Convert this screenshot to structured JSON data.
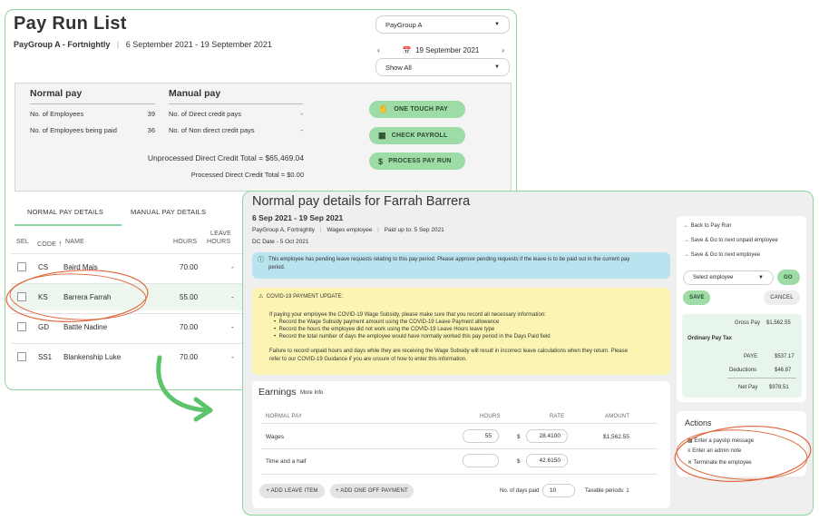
{
  "pay_run": {
    "title": "Pay Run List",
    "group_label": "PayGroup A - Fortnightly",
    "period": "6 September 2021 - 19 September 2021",
    "paygroup_select": "PayGroup A",
    "date_nav": "19 September 2021",
    "filter_select": "Show All",
    "normal_pay": {
      "heading": "Normal pay",
      "employees_label": "No. of Employees",
      "employees_value": "39",
      "paid_label": "No. of Employees being paid",
      "paid_value": "36"
    },
    "manual_pay": {
      "heading": "Manual pay",
      "direct_label": "No. of Direct credit pays",
      "direct_value": "-",
      "non_direct_label": "No. of Non direct credit pays",
      "non_direct_value": "-"
    },
    "unprocessed_total": "Unprocessed Direct Credit Total  =  $65,469.04",
    "processed_total": "Processed Direct Credit Total  =  $0.00",
    "buttons": {
      "one_touch": "ONE TOUCH PAY",
      "check_payroll": "CHECK PAYROLL",
      "process": "PROCESS PAY RUN"
    },
    "tabs": [
      "NORMAL PAY DETAILS",
      "MANUAL PAY DETAILS"
    ],
    "columns": {
      "sel": "SEL",
      "code": "CODE",
      "name": "NAME",
      "hours": "HOURS",
      "leave_1": "LEAVE",
      "leave_2": "HOURS"
    },
    "rows": [
      {
        "code": "CS",
        "name": "Baird Mais",
        "hours": "70.00",
        "leave": "-"
      },
      {
        "code": "KS",
        "name": "Barrera Farrah",
        "hours": "55.00",
        "leave": "-"
      },
      {
        "code": "GD",
        "name": "Battle Nadine",
        "hours": "70.00",
        "leave": "-"
      },
      {
        "code": "SS1",
        "name": "Blankenship Luke",
        "hours": "70.00",
        "leave": "-"
      }
    ]
  },
  "details": {
    "title": "Normal pay details for Farrah Barrera",
    "date_range": "6 Sep 2021 - 19 Sep 2021",
    "meta_group": "PayGroup A, Fortnightly",
    "meta_type": "Wages employee",
    "meta_paid": "Paid up to: 5 Sep 2021",
    "dc_date": "DC Date - 5 Oct 2021",
    "info_1": "This employee has pending leave requests relating to this pay period. Please approve pending requests if the leave is to be paid out in the current pay",
    "info_2": "period.",
    "covid_title": "COVID-19 PAYMENT UPDATE:",
    "covid_intro": "If paying your employee the COVID-19 Wage Subsidy, please make sure that you record all necessary information:",
    "covid_bullets": [
      "Record the Wage Subsidy payment amount using the COVID-19 Leave Payment allowance",
      "Record the hours the employee did not work using the COVID-19 Leave Hours leave type",
      "Record the total number of days the employee would have normally worked this pay period in the Days Paid field"
    ],
    "covid_footer_1": "Failure to record unpaid hours and days while they are receiving the Wage Subsidy will result in incorrect leave calculations when they return. Please",
    "covid_footer_2": "refer to our COVID-19 Guidance if you are unsure of how to enter this information.",
    "earnings": {
      "title": "Earnings",
      "more_info": "More Info",
      "col_normal": "NORMAL PAY",
      "col_hours": "HOURS",
      "col_rate": "RATE",
      "col_amount": "AMOUNT",
      "rows": [
        {
          "label": "Wages",
          "hours": "55",
          "currency": "$",
          "rate": "28.4100",
          "amount": "$1,562.55"
        },
        {
          "label": "Time and a half",
          "hours": "",
          "currency": "$",
          "rate": "42.6150",
          "amount": ""
        }
      ],
      "add_leave": "+ ADD LEAVE ITEM",
      "add_one_off": "+ ADD ONE OFF PAYMENT",
      "days_paid_label": "No. of days paid",
      "days_paid_value": "10",
      "taxable_periods": "Taxable periods: 1"
    },
    "nav": {
      "back": "Back to Pay Run",
      "next_unpaid": "Save & Go to next unpaid employee",
      "next": "Save & Go to next employee",
      "select_placeholder": "Select employee",
      "go": "GO",
      "save": "SAVE",
      "cancel": "CANCEL"
    },
    "summary": {
      "gross_label": "Gross Pay",
      "gross_value": "$1,562.55",
      "ordinary": "Ordinary Pay Tax",
      "paye_label": "PAYE",
      "paye_value": "$537.17",
      "ded_label": "Deductions",
      "ded_value": "$46.87",
      "net_label": "Net Pay",
      "net_value": "$978.51"
    },
    "actions": {
      "title": "Actions",
      "payslip": "Enter a payslip message",
      "admin": "Enter an admin note",
      "terminate": "Terminate the employee"
    }
  },
  "colors": {
    "accent_green": "#9ddba7",
    "border_green": "#8fd49a",
    "annotation_orange": "#e0643a",
    "info_blue": "#b9e3ee",
    "warning_yellow": "#fbf4b3"
  }
}
